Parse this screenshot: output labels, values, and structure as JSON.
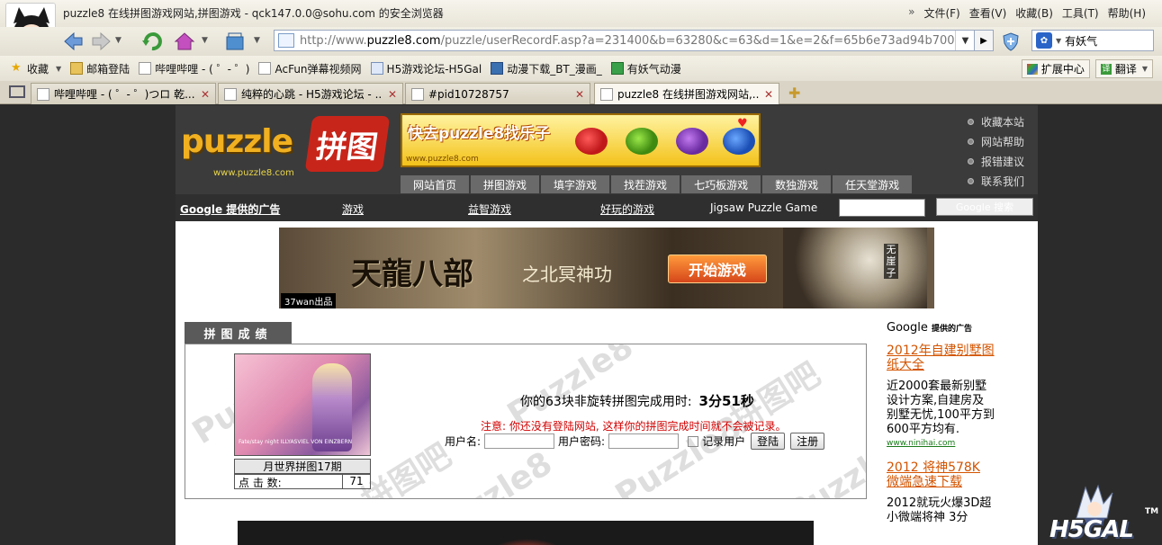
{
  "browser": {
    "title": "puzzle8 在线拼图游戏网站,拼图游戏 - qck147.0.0@sohu.com 的安全浏览器",
    "menu": [
      "文件(F)",
      "查看(V)",
      "收藏(B)",
      "工具(T)",
      "帮助(H)"
    ],
    "address": {
      "prefix": "http://www.",
      "host": "puzzle8.com",
      "path": "/puzzle/userRecordF.asp?a=231400&b=63280&c=63&d=1&e=2&f=65b6e73ad94b7007&ne"
    },
    "search_text": "有妖气",
    "bookmarks": [
      "收藏",
      "邮箱登陆",
      "哔哩哔哩 - ( ゜- ゜)",
      "AcFun弹幕视频网",
      "H5游戏论坛-H5Gal",
      "动漫下载_BT_漫画_",
      "有妖气动漫"
    ],
    "bookmarks_right": [
      "扩展中心",
      "翻译"
    ],
    "tabs": [
      {
        "label": "哔哩哔哩 - ( ゜- ゜)つロ 乾..."
      },
      {
        "label": "纯粹的心跳 - H5游戏论坛 - ..."
      },
      {
        "label": "#pid10728757"
      },
      {
        "label": "puzzle8 在线拼图游戏网站,..."
      }
    ]
  },
  "site": {
    "logo_word": "puzzle",
    "logo_cn": "拼图",
    "logo_url": "www.puzzle8.com",
    "top_banner": {
      "text": "快去puzzle8找乐子",
      "url": "www.puzzle8.com"
    },
    "top_links": [
      "收藏本站",
      "网站帮助",
      "报错建议",
      "联系我们"
    ],
    "categories": [
      "网站首页",
      "拼图游戏",
      "填字游戏",
      "找茬游戏",
      "七巧板游戏",
      "数独游戏",
      "任天堂游戏"
    ],
    "adbar": {
      "google_label": "Google 提供的广告",
      "links": [
        "游戏",
        "益智游戏",
        "好玩的游戏"
      ],
      "jigsaw": "Jigsaw Puzzle Game",
      "search_button": "Google 搜索"
    },
    "game_banner": {
      "title": "天龍八部",
      "subtitle": "之北冥神功",
      "play": "开始游戏",
      "from": "37wan出品",
      "side": "无崖子"
    }
  },
  "score": {
    "tab": "拼图成绩",
    "thumb_caption": "Fate/stay night ILLYASVIEL VON EINZBERN",
    "thumb_title": "月世界拼图17期",
    "clicks_label": "点 击 数:",
    "clicks_value": "71",
    "result_text": "你的63块非旋转拼图完成用时:",
    "result_time": "3分51秒",
    "notice": "注意: 你还没有登陆网站, 这样你的拼图完成时间就不会被记录。",
    "username_label": "用户名:",
    "password_label": "用户密码:",
    "remember_label": "记录用户",
    "login_button": "登陆",
    "register_button": "注册",
    "watermarks": [
      "Puzzle8",
      "拼图吧"
    ]
  },
  "right_ads": {
    "google_label": "Google",
    "google_sub": "提供的广告",
    "ads": [
      {
        "title": "2012年自建别墅图纸大全",
        "body": "近2000套最新别墅设计方案,自建房及 别墅无忧,100平方到600平方均有.",
        "link": "www.ninihai.com"
      },
      {
        "title": "2012 将神578K 微端急速下载",
        "body": "2012就玩火爆3D超小微端将神 3分"
      }
    ]
  },
  "watermark_logo": {
    "text": "H5GAL",
    "tm": "TM"
  }
}
